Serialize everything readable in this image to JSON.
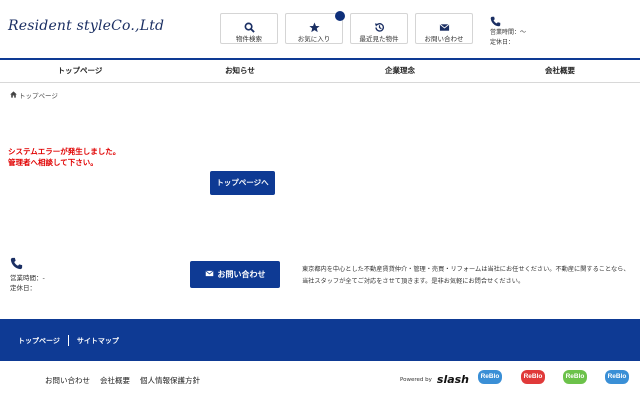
{
  "header": {
    "logo_text": "Resident styleCo.,Ltd",
    "buttons": [
      {
        "label": "物件検索",
        "icon": "search-icon"
      },
      {
        "label": "お気に入り",
        "icon": "star-icon"
      },
      {
        "label": "最近見た物件",
        "icon": "history-icon"
      },
      {
        "label": "お問い合わせ",
        "icon": "mail-icon"
      }
    ],
    "hours_label": "営業時間：～",
    "holiday_label": "定休日："
  },
  "nav": {
    "items": [
      "トップページ",
      "お知らせ",
      "企業理念",
      "会社概要"
    ]
  },
  "breadcrumb": {
    "label": "トップページ"
  },
  "error": {
    "line1": "システムエラーが発生しました。",
    "line2": "管理者へ相談して下さい。"
  },
  "main": {
    "top_button": "トップページへ"
  },
  "info": {
    "hours": "営業時間：-",
    "holiday": "定休日：",
    "contact_button": "お問い合わせ",
    "note": "東京都内を中心とした不動産賃貸仲介・管理・売買・リフォームは当社にお任せください。不動産に関することなら、当社スタッフが全てご対応をさせて頂きます。是非お気軽にお問合せください。"
  },
  "footer": {
    "links": [
      "トップページ",
      "サイトマップ"
    ],
    "bottom_links": [
      "お問い合わせ",
      "会社概要",
      "個人情報保護方針"
    ],
    "powered_by": "Powered by",
    "powered_brand": "slash",
    "reblo_badges": [
      {
        "label": "ReBlo",
        "color": "#3a8fd6"
      },
      {
        "label": "ReBlo",
        "color": "#e03a3a"
      },
      {
        "label": "ReBlo",
        "color": "#6cc24a"
      },
      {
        "label": "ReBlo",
        "color": "#3a8fd6"
      }
    ]
  },
  "colors": {
    "brand": "#0e3a94",
    "error": "#e00000"
  }
}
